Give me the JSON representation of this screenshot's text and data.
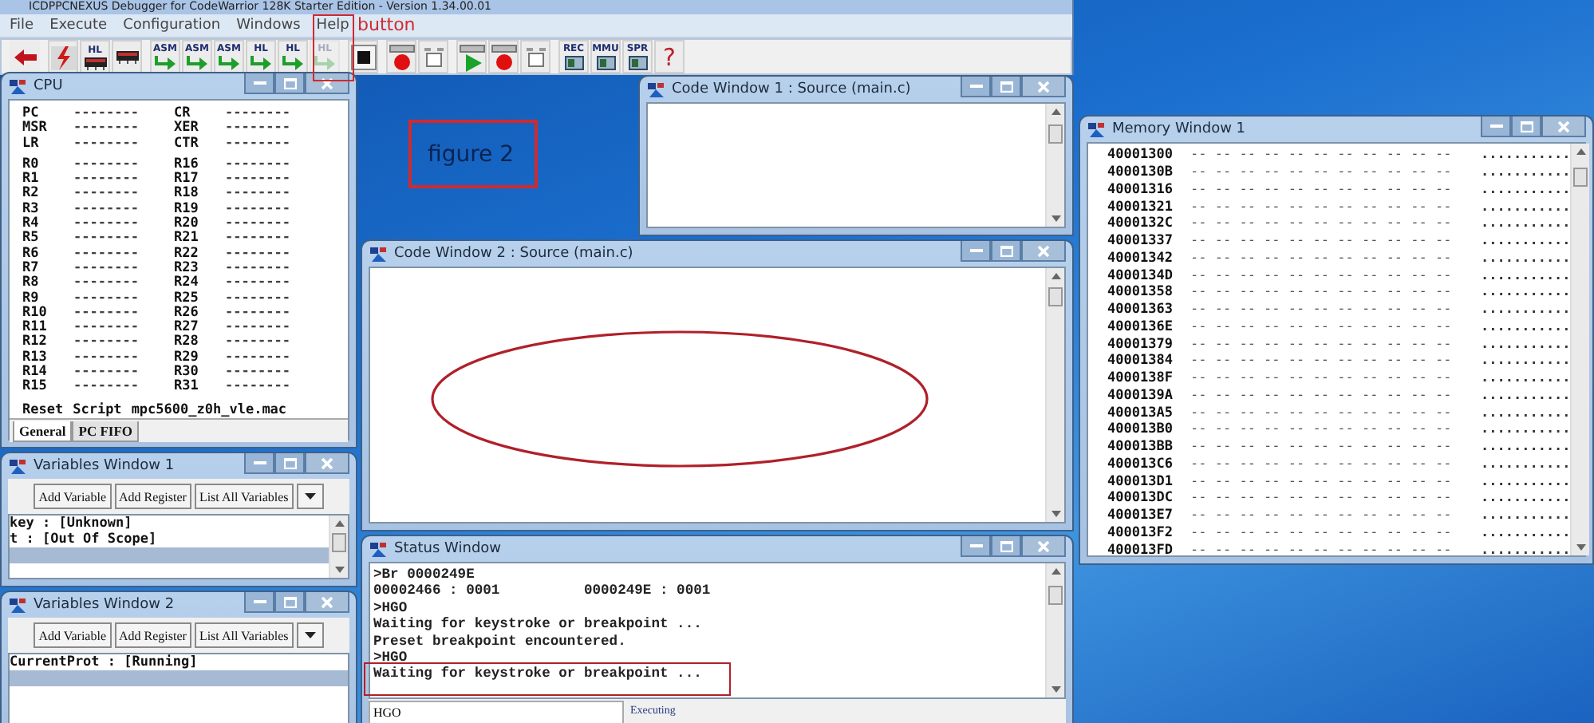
{
  "main_window": {
    "title": "ICDPPCNEXUS Debugger for CodeWarrior 128K Starter Edition - Version 1.34.00.01",
    "menu": [
      "File",
      "Execute",
      "Configuration",
      "Windows",
      "Help"
    ],
    "toolbar": [
      [
        {
          "kind": "back",
          "disabled": false
        }
      ],
      [
        {
          "kind": "flash",
          "disabled": false
        },
        {
          "kind": "chip",
          "label": "HL",
          "disabled": false
        },
        {
          "kind": "chip",
          "disabled": false
        }
      ],
      [
        {
          "kind": "step",
          "label": "ASM",
          "disabled": false
        },
        {
          "kind": "step",
          "label": "ASM",
          "disabled": false
        },
        {
          "kind": "step",
          "label": "ASM",
          "disabled": false
        },
        {
          "kind": "step",
          "label": "HL",
          "disabled": false
        },
        {
          "kind": "step",
          "label": "HL",
          "disabled": false
        },
        {
          "kind": "step",
          "label": "HL",
          "disabled": true
        }
      ],
      [
        {
          "kind": "stop",
          "disabled": false
        }
      ],
      [
        {
          "kind": "breakpoint",
          "disabled": false
        },
        {
          "kind": "box",
          "disabled": false
        }
      ],
      [
        {
          "kind": "go",
          "disabled": false
        },
        {
          "kind": "breakpoint",
          "disabled": false
        },
        {
          "kind": "box",
          "disabled": false
        }
      ],
      [
        {
          "kind": "board",
          "label": "REC",
          "disabled": false
        },
        {
          "kind": "board",
          "label": "MMU",
          "disabled": false
        },
        {
          "kind": "board",
          "label": "SPR",
          "disabled": false
        },
        {
          "kind": "help",
          "label": "?",
          "disabled": false
        }
      ]
    ]
  },
  "cpu_window": {
    "title": "CPU",
    "groups": [
      [
        [
          "PC",
          "--------",
          "CR",
          "--------"
        ],
        [
          "MSR",
          "--------",
          "XER",
          "--------"
        ],
        [
          "LR",
          "--------",
          "CTR",
          "--------"
        ]
      ],
      [
        [
          "R0",
          "--------",
          "R16",
          "--------"
        ],
        [
          "R1",
          "--------",
          "R17",
          "--------"
        ],
        [
          "R2",
          "--------",
          "R18",
          "--------"
        ],
        [
          "R3",
          "--------",
          "R19",
          "--------"
        ],
        [
          "R4",
          "--------",
          "R20",
          "--------"
        ],
        [
          "R5",
          "--------",
          "R21",
          "--------"
        ],
        [
          "R6",
          "--------",
          "R22",
          "--------"
        ],
        [
          "R7",
          "--------",
          "R23",
          "--------"
        ],
        [
          "R8",
          "--------",
          "R24",
          "--------"
        ],
        [
          "R9",
          "--------",
          "R25",
          "--------"
        ],
        [
          "R10",
          "--------",
          "R26",
          "--------"
        ],
        [
          "R11",
          "--------",
          "R27",
          "--------"
        ],
        [
          "R12",
          "--------",
          "R28",
          "--------"
        ],
        [
          "R13",
          "--------",
          "R29",
          "--------"
        ],
        [
          "R14",
          "--------",
          "R30",
          "--------"
        ],
        [
          "R15",
          "--------",
          "R31",
          "--------"
        ]
      ]
    ],
    "script_bar": [
      "Reset",
      "Script",
      "mpc5600_z0h_vle.mac"
    ],
    "tabs": [
      {
        "label": "General",
        "selected": true
      },
      {
        "label": "PC FIFO",
        "selected": false
      }
    ]
  },
  "variables_windows": [
    {
      "title": "Variables Window 1",
      "buttons": [
        "Add Variable",
        "Add Register",
        "List All Variables"
      ],
      "lines": [
        "key : [Unknown]",
        "t : [Out Of Scope]"
      ],
      "empty_selected_row": true,
      "scrollbar": true
    },
    {
      "title": "Variables Window 2",
      "buttons": [
        "Add Variable",
        "Add Register",
        "List All Variables"
      ],
      "lines": [
        "CurrentProt : [Running]"
      ],
      "empty_selected_row": true
    }
  ],
  "code_windows": [
    {
      "title": "Code Window 1 : Source (main.c)"
    },
    {
      "title": "Code Window 2 : Source (main.c)"
    }
  ],
  "status_window": {
    "title": "Status Window",
    "lines": [
      ">Br 0000249E",
      "00002466 : 0001          0000249E : 0001",
      ">HGO",
      "Waiting for keystroke or breakpoint ...",
      "Preset breakpoint encountered.",
      ">HGO",
      "Waiting for keystroke or breakpoint ..."
    ],
    "command": "HGO",
    "state": "Executing"
  },
  "memory_window": {
    "title": "Memory Window 1",
    "rows": [
      {
        "address": "40001300",
        "bytes": "-- -- -- -- -- -- -- -- -- -- --",
        "ascii": "..........."
      },
      {
        "address": "4000130B",
        "bytes": "-- -- -- -- -- -- -- -- -- -- --",
        "ascii": "..........."
      },
      {
        "address": "40001316",
        "bytes": "-- -- -- -- -- -- -- -- -- -- --",
        "ascii": "..........."
      },
      {
        "address": "40001321",
        "bytes": "-- -- -- -- -- -- -- -- -- -- --",
        "ascii": "..........."
      },
      {
        "address": "4000132C",
        "bytes": "-- -- -- -- -- -- -- -- -- -- --",
        "ascii": "..........."
      },
      {
        "address": "40001337",
        "bytes": "-- -- -- -- -- -- -- -- -- -- --",
        "ascii": "..........."
      },
      {
        "address": "40001342",
        "bytes": "-- -- -- -- -- -- -- -- -- -- --",
        "ascii": "..........."
      },
      {
        "address": "4000134D",
        "bytes": "-- -- -- -- -- -- -- -- -- -- --",
        "ascii": "..........."
      },
      {
        "address": "40001358",
        "bytes": "-- -- -- -- -- -- -- -- -- -- --",
        "ascii": "..........."
      },
      {
        "address": "40001363",
        "bytes": "-- -- -- -- -- -- -- -- -- -- --",
        "ascii": "..........."
      },
      {
        "address": "4000136E",
        "bytes": "-- -- -- -- -- -- -- -- -- -- --",
        "ascii": "..........."
      },
      {
        "address": "40001379",
        "bytes": "-- -- -- -- -- -- -- -- -- -- --",
        "ascii": "..........."
      },
      {
        "address": "40001384",
        "bytes": "-- -- -- -- -- -- -- -- -- -- --",
        "ascii": "..........."
      },
      {
        "address": "4000138F",
        "bytes": "-- -- -- -- -- -- -- -- -- -- --",
        "ascii": "..........."
      },
      {
        "address": "4000139A",
        "bytes": "-- -- -- -- -- -- -- -- -- -- --",
        "ascii": "..........."
      },
      {
        "address": "400013A5",
        "bytes": "-- -- -- -- -- -- -- -- -- -- --",
        "ascii": "..........."
      },
      {
        "address": "400013B0",
        "bytes": "-- -- -- -- -- -- -- -- -- -- --",
        "ascii": "..........."
      },
      {
        "address": "400013BB",
        "bytes": "-- -- -- -- -- -- -- -- -- -- --",
        "ascii": "..........."
      },
      {
        "address": "400013C6",
        "bytes": "-- -- -- -- -- -- -- -- -- -- --",
        "ascii": "..........."
      },
      {
        "address": "400013D1",
        "bytes": "-- -- -- -- -- -- -- -- -- -- --",
        "ascii": "..........."
      },
      {
        "address": "400013DC",
        "bytes": "-- -- -- -- -- -- -- -- -- -- --",
        "ascii": "..........."
      },
      {
        "address": "400013E7",
        "bytes": "-- -- -- -- -- -- -- -- -- -- --",
        "ascii": "..........."
      },
      {
        "address": "400013F2",
        "bytes": "-- -- -- -- -- -- -- -- -- -- --",
        "ascii": "..........."
      },
      {
        "address": "400013FD",
        "bytes": "-- -- -- -- -- -- -- -- -- -- --",
        "ascii": "..........."
      }
    ]
  },
  "annotations": [
    {
      "kind": "callout",
      "text": "button"
    },
    {
      "kind": "label",
      "text": "figure 2"
    },
    {
      "kind": "ellipse"
    },
    {
      "kind": "highlight"
    }
  ]
}
